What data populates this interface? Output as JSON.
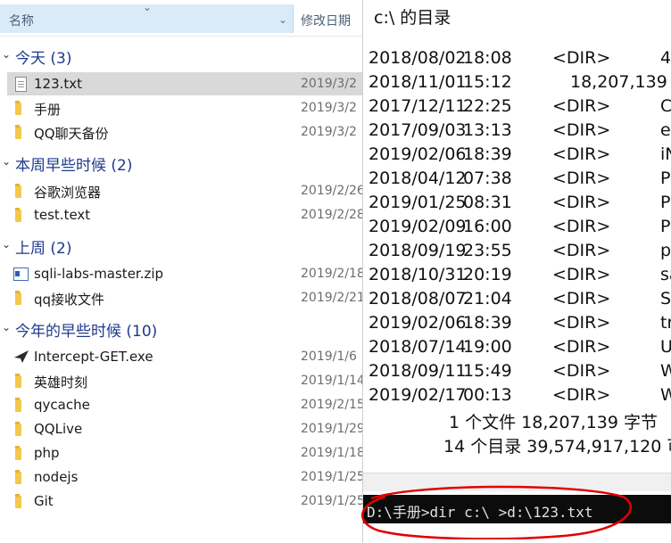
{
  "explorer": {
    "columns": {
      "name": "名称",
      "date": "修改日期"
    },
    "groups": [
      {
        "title": "今天 (3)",
        "items": [
          {
            "name": "123.txt",
            "date": "2019/3/2",
            "icon": "text-file-icon",
            "selected": true
          },
          {
            "name": "手册",
            "date": "2019/3/2",
            "icon": "folder-icon"
          },
          {
            "name": "QQ聊天备份",
            "date": "2019/3/2",
            "icon": "folder-icon"
          }
        ]
      },
      {
        "title": "本周早些时候 (2)",
        "items": [
          {
            "name": "谷歌浏览器",
            "date": "2019/2/26",
            "icon": "folder-icon"
          },
          {
            "name": "test.text",
            "date": "2019/2/28",
            "icon": "folder-icon"
          }
        ]
      },
      {
        "title": "上周 (2)",
        "items": [
          {
            "name": "sqli-labs-master.zip",
            "date": "2019/2/18",
            "icon": "zip-file-icon"
          },
          {
            "name": "qq接收文件",
            "date": "2019/2/21",
            "icon": "folder-icon"
          }
        ]
      },
      {
        "title": "今年的早些时候 (10)",
        "items": [
          {
            "name": "Intercept-GET.exe",
            "date": "2019/1/6",
            "icon": "exe-file-icon"
          },
          {
            "name": "英雄时刻",
            "date": "2019/1/14",
            "icon": "folder-icon"
          },
          {
            "name": "qycache",
            "date": "2019/2/15",
            "icon": "folder-icon"
          },
          {
            "name": "QQLive",
            "date": "2019/1/29",
            "icon": "folder-icon"
          },
          {
            "name": "php",
            "date": "2019/1/18",
            "icon": "folder-icon"
          },
          {
            "name": "nodejs",
            "date": "2019/1/25",
            "icon": "folder-icon"
          },
          {
            "name": "Git",
            "date": "2019/1/25",
            "icon": "folder-icon"
          }
        ]
      }
    ]
  },
  "console": {
    "title": "c:\\ 的目录",
    "entries": [
      {
        "date": "2018/08/02",
        "time": "18:08",
        "kind": "<DIR>",
        "name": "4"
      },
      {
        "date": "2018/11/01",
        "time": "15:12",
        "kind": "18,207,139",
        "name": ""
      },
      {
        "date": "2017/12/11",
        "time": "22:25",
        "kind": "<DIR>",
        "name": "C"
      },
      {
        "date": "2017/09/03",
        "time": "13:13",
        "kind": "<DIR>",
        "name": "e"
      },
      {
        "date": "2019/02/06",
        "time": "18:39",
        "kind": "<DIR>",
        "name": "iN"
      },
      {
        "date": "2018/04/12",
        "time": "07:38",
        "kind": "<DIR>",
        "name": "P"
      },
      {
        "date": "2019/01/25",
        "time": "08:31",
        "kind": "<DIR>",
        "name": "P"
      },
      {
        "date": "2019/02/09",
        "time": "16:00",
        "kind": "<DIR>",
        "name": "P"
      },
      {
        "date": "2018/09/19",
        "time": "23:55",
        "kind": "<DIR>",
        "name": "p"
      },
      {
        "date": "2018/10/31",
        "time": "20:19",
        "kind": "<DIR>",
        "name": "sa"
      },
      {
        "date": "2018/08/07",
        "time": "21:04",
        "kind": "<DIR>",
        "name": "S"
      },
      {
        "date": "2019/02/06",
        "time": "18:39",
        "kind": "<DIR>",
        "name": "tr"
      },
      {
        "date": "2018/07/14",
        "time": "19:00",
        "kind": "<DIR>",
        "name": "U"
      },
      {
        "date": "2018/09/11",
        "time": "15:49",
        "kind": "<DIR>",
        "name": "W"
      },
      {
        "date": "2019/02/17",
        "time": "00:13",
        "kind": "<DIR>",
        "name": "W"
      }
    ],
    "summary_files": "1 个文件     18,207,139 字节",
    "summary_dirs": "14 个目录 39,574,917,120 可",
    "command": "D:\\手册>dir c:\\ >d:\\123.txt"
  },
  "colors": {
    "group_title": "#1e3a8c",
    "selected_row": "#d9d9d9",
    "header_highlight": "#d9ebf9",
    "annotation": "#e00000"
  }
}
